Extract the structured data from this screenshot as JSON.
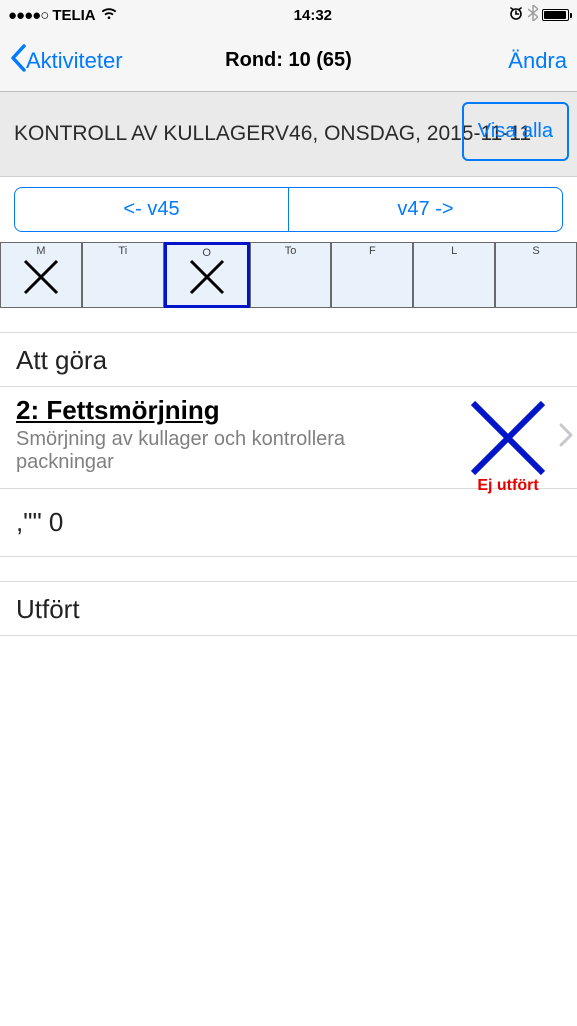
{
  "status": {
    "carrier": "TELIA",
    "time": "14:32"
  },
  "nav": {
    "back": "Aktiviteter",
    "title": "Rond: 10 (65)",
    "edit": "Ändra"
  },
  "header": {
    "info": "KONTROLL AV KULLAGERV46, ONSDAG, 2015-11-11",
    "show_all": "Visa alla"
  },
  "week_nav": {
    "prev": "<- v45",
    "next": "v47 ->"
  },
  "days": [
    {
      "label": "M",
      "marked": true,
      "selected": false
    },
    {
      "label": "Ti",
      "marked": false,
      "selected": false
    },
    {
      "label": "O",
      "marked": true,
      "selected": true
    },
    {
      "label": "To",
      "marked": false,
      "selected": false
    },
    {
      "label": "F",
      "marked": false,
      "selected": false
    },
    {
      "label": "L",
      "marked": false,
      "selected": false
    },
    {
      "label": "S",
      "marked": false,
      "selected": false
    }
  ],
  "sections": {
    "todo_header": "Att göra",
    "done_header": "Utfört"
  },
  "task": {
    "title": "2: Fettsmörjning",
    "desc": "Smörjning av kullager och kontrollera packningar",
    "status_label": "Ej utfört"
  },
  "footer": {
    "text": ",\"\" 0"
  }
}
